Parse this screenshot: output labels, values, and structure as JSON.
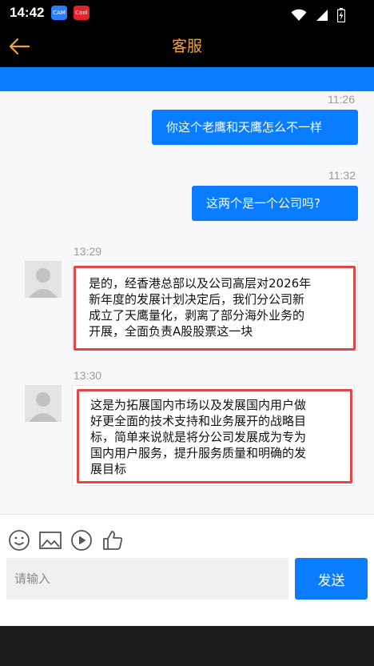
{
  "status_bar": {
    "time": "14:42",
    "app_icon_1_label": "CAM",
    "app_icon_2_label": "Cool"
  },
  "header": {
    "title": "客服"
  },
  "messages": [
    {
      "time": "11:26",
      "from": "user",
      "text": "你这个老鹰和天鹰怎么不一样"
    },
    {
      "time": "11:32",
      "from": "user",
      "text": "这两个是一个公司吗?"
    },
    {
      "time": "13:29",
      "from": "agent",
      "lines": [
        "是的，经香港总部以及公司高层对2026年",
        "新年度的发展计划决定后，我们分公司新",
        "成立了天鹰量化，剥离了部分海外业务的",
        "开展，全面负责A股股票这一块"
      ]
    },
    {
      "time": "13:30",
      "from": "agent",
      "lines": [
        "这是为拓展国内市场以及发展国内用户做",
        "好更全面的技术支持和业务展开的战略目",
        "标，简单来说就是将分公司发展成为专为",
        "国内用户服务，提升服务质量和明确的发",
        "展目标"
      ]
    }
  ],
  "input": {
    "placeholder": "请输入",
    "send_label": "发送"
  },
  "colors": {
    "accent": "#0a7cff",
    "title": "#f0a23c",
    "highlight": "#e04848"
  }
}
